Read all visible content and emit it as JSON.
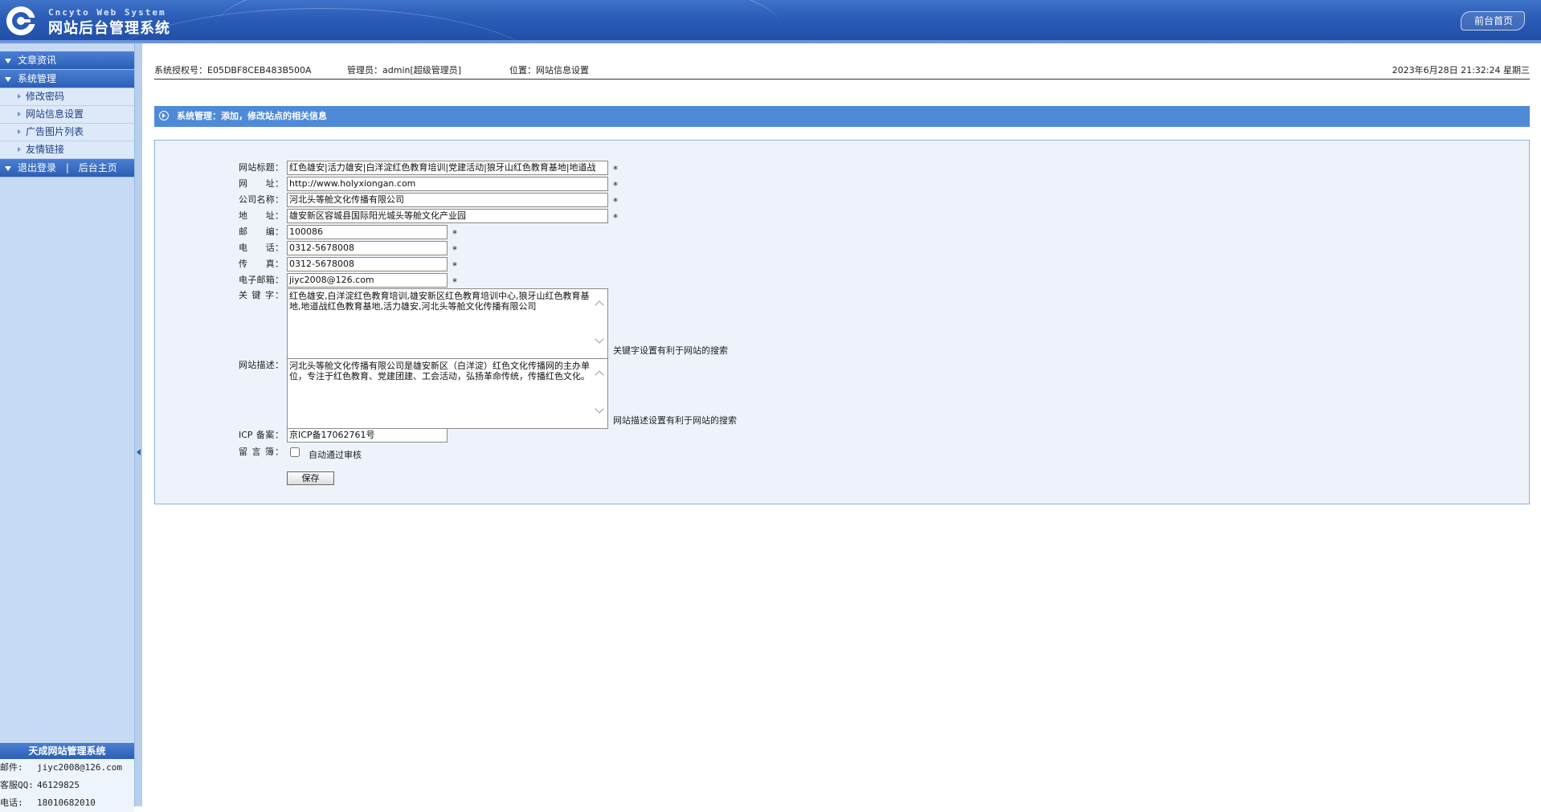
{
  "header": {
    "brand_en": "Cncyto Web System",
    "brand_cn": "网站后台管理系统",
    "front_link": "前台首页",
    "logo_icon": "c-logo-icon"
  },
  "sidebar": {
    "groups": [
      {
        "label": "文章资讯"
      },
      {
        "label": "系统管理"
      }
    ],
    "sub_items": [
      "修改密码",
      "网站信息设置",
      "广告图片列表",
      "友情链接"
    ],
    "logout": "退出登录",
    "divider": "|",
    "home": "后台主页",
    "footer": {
      "title": "天成网站管理系统",
      "email_label": "邮件:",
      "email": "jiyc2008@126.com",
      "qq_label": "客服QQ:",
      "qq": "46129825",
      "phone_label": "电话:",
      "phone": "18010682010"
    }
  },
  "infobar": {
    "license": "系统授权号：E05DBF8CEB483B500A",
    "admin": "管理员：admin[超级管理员]",
    "location": "位置：网站信息设置",
    "datetime": "2023年6月28日 21:32:24 星期三"
  },
  "section": {
    "title": "系统管理：添加，修改站点的相关信息"
  },
  "form": {
    "site_title": {
      "label": "网站标题：",
      "value": "红色雄安|活力雄安|白洋淀红色教育培训|党建活动|狼牙山红色教育基地|地道战"
    },
    "url": {
      "label": "网　　址：",
      "value": "http://www.holyxiongan.com"
    },
    "company": {
      "label": "公司名称：",
      "value": "河北头等舱文化传播有限公司"
    },
    "address": {
      "label": "地　　址：",
      "value": "雄安新区容城县国际阳光城头等舱文化产业园"
    },
    "postcode": {
      "label": "邮　　编：",
      "value": "100086"
    },
    "phone": {
      "label": "电　　话：",
      "value": "0312-5678008"
    },
    "fax": {
      "label": "传　　真：",
      "value": "0312-5678008"
    },
    "email": {
      "label": "电子邮箱：",
      "value": "jiyc2008@126.com"
    },
    "keywords": {
      "label": "关 键 字：",
      "value": "红色雄安,白洋淀红色教育培训,雄安新区红色教育培训中心,狼牙山红色教育基地,地道战红色教育基地,活力雄安,河北头等舱文化传播有限公司",
      "hint": "关键字设置有利于网站的搜索"
    },
    "description": {
      "label": "网站描述：",
      "value": "河北头等舱文化传播有限公司是雄安新区（白洋淀）红色文化传播网的主办单位，专注于红色教育、党建团建、工会活动，弘扬革命传统，传播红色文化。",
      "hint": "网站描述设置有利于网站的搜索"
    },
    "icp": {
      "label": "ICP 备案：",
      "value": "京ICP备17062761号"
    },
    "guestbook": {
      "label": "留 言 簿：",
      "checkbox_label": "自动通过审核",
      "checked": false
    },
    "required_mark": "*",
    "save_label": "保存"
  },
  "colors": {
    "header_blue": "#2a5bb6",
    "sidebar_bg": "#c6daf3",
    "section_bar": "#4f8ad9",
    "panel_bg": "#eef3fb"
  }
}
